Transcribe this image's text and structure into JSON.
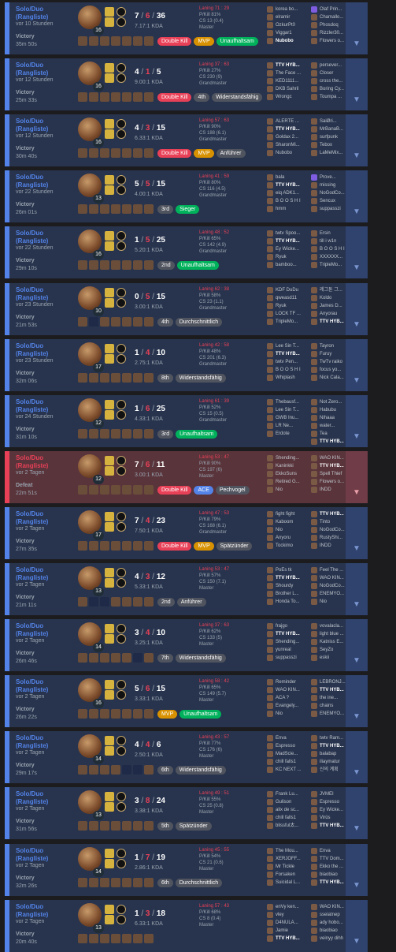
{
  "colors": {
    "win_bg": "#28344e",
    "win_accent": "#5383e8",
    "loss_bg": "#59343b",
    "loss_accent": "#e84057"
  },
  "icons": {
    "expand": "chevron-down-icon",
    "lane": "lane-icon",
    "rank": "rank-crest-icon"
  },
  "scroll_arrow": "▼",
  "matches": [
    {
      "id": "m1",
      "result_type": "win",
      "queue": "Solo/Duo\n(Rangliste)",
      "time_ago": "vor 10 Stunden",
      "result": "Victory",
      "duration": "35m 50s",
      "level": "16",
      "kda": {
        "k": "7",
        "d": "6",
        "a": "36"
      },
      "ratio": "7.17:1 KDA",
      "lane": "Laning 71 : 29",
      "kill_p": "P/Kill 81%",
      "cs": "CS 13 (0.4)",
      "rank": "Master",
      "tags": [
        {
          "label": "Double Kill",
          "style": "red"
        },
        {
          "label": "MVP",
          "style": "gold"
        },
        {
          "label": "Unaufhaltsam",
          "style": "green"
        }
      ],
      "blue": [
        "korea bo...",
        "elramir",
        "OzkurPt0",
        "Viggar1",
        "Nubobo"
      ],
      "red": [
        "Olaf Prin...",
        "Chamallo...",
        "Phosdoq",
        "Rizzler30...",
        "Flowers o..."
      ],
      "me": "blue-4",
      "ward": "red-0",
      "items": [
        1,
        1,
        1,
        1,
        1,
        1,
        1
      ]
    },
    {
      "id": "m2",
      "result_type": "win",
      "queue": "Solo/Duo\n(Rangliste)",
      "time_ago": "vor 12 Stunden",
      "result": "Victory",
      "duration": "25m 33s",
      "level": "16",
      "kda": {
        "k": "4",
        "d": "1",
        "a": "5"
      },
      "ratio": "9.00:1 KDA",
      "lane": "Laning 37 : 63",
      "kill_p": "P/Kill 27%",
      "cs": "CS 230 (9)",
      "rank": "Grandmaster",
      "tags": [
        {
          "label": "Double Kill",
          "style": "red"
        },
        {
          "label": "4th",
          "style": "grey"
        },
        {
          "label": "Widerstandsfähig",
          "style": "grey"
        }
      ],
      "blue": [
        "TTV HYB...",
        "The Face ...",
        "KED1111...",
        "DKB Sahril",
        "Wrongc"
      ],
      "red": [
        "persever...",
        "Closer",
        "cross the...",
        "Boring Cy...",
        "Toumpa ..."
      ],
      "me": "blue-0",
      "ward": "",
      "items": [
        1,
        1,
        1,
        1,
        1,
        1,
        1
      ]
    },
    {
      "id": "m3",
      "result_type": "win",
      "queue": "Solo/Duo\n(Rangliste)",
      "time_ago": "vor 12 Stunden",
      "result": "Victory",
      "duration": "30m 40s",
      "level": "16",
      "kda": {
        "k": "4",
        "d": "3",
        "a": "15"
      },
      "ratio": "6.33:1 KDA",
      "lane": "Laning 57 : 63",
      "kill_p": "P/Kill 90%",
      "cs": "CS 188 (6.1)",
      "rank": "Grandmaster",
      "tags": [
        {
          "label": "Double Kill",
          "style": "red"
        },
        {
          "label": "MVP",
          "style": "gold"
        },
        {
          "label": "Anführer",
          "style": "grey"
        }
      ],
      "blue": [
        "ALERTE ...",
        "TTV HYB...",
        "Goldax 2...",
        "SharonMi...",
        "Nubobo"
      ],
      "red": [
        "SaiØri...",
        "MrBanaB...",
        "surfpunk",
        "Tebox",
        "LaMeMix..."
      ],
      "me": "blue-1",
      "ward": "",
      "items": [
        1,
        1,
        1,
        1,
        1,
        1,
        1
      ]
    },
    {
      "id": "m4",
      "result_type": "win",
      "queue": "Solo/Duo\n(Rangliste)",
      "time_ago": "vor 22 Stunden",
      "result": "Victory",
      "duration": "26m 01s",
      "level": "13",
      "kda": {
        "k": "5",
        "d": "5",
        "a": "15"
      },
      "ratio": "4.00:1 KDA",
      "lane": "Laning 41 : 59",
      "kill_p": "P/Kill 80%",
      "cs": "CS 116 (4.5)",
      "rank": "Grandmaster",
      "tags": [
        {
          "label": "3rd",
          "style": "grey"
        },
        {
          "label": "Sieger",
          "style": "green"
        }
      ],
      "blue": [
        "bala",
        "TTV HYB...",
        "eiq ADK1...",
        "B O O S H I",
        "hmm"
      ],
      "red": [
        "Prove...",
        "missing",
        "NoGodCo...",
        "Sencux",
        "suppasszi"
      ],
      "me": "blue-1",
      "ward": "red-0",
      "items": [
        1,
        1,
        1,
        1,
        1,
        1,
        1
      ]
    },
    {
      "id": "m5",
      "result_type": "win",
      "queue": "Solo/Duo\n(Rangliste)",
      "time_ago": "vor 22 Stunden",
      "result": "Victory",
      "duration": "29m 10s",
      "level": "16",
      "kda": {
        "k": "1",
        "d": "5",
        "a": "25"
      },
      "ratio": "5.20:1 KDA",
      "lane": "Laning 48 : 52",
      "kill_p": "P/Kill 65%",
      "cs": "CS 142 (4.9)",
      "rank": "Grandmaster",
      "tags": [
        {
          "label": "2nd",
          "style": "grey"
        },
        {
          "label": "Unaufhaltsam",
          "style": "green"
        }
      ],
      "blue": [
        "twtv Spoo...",
        "TTV HYB...",
        "Ey Wicke...",
        "Ryuk",
        "bamboo..."
      ],
      "red": [
        "Ersin",
        "till i w1n",
        "B O O S H I",
        "XXXXXX...",
        "TripleMo..."
      ],
      "me": "blue-1",
      "ward": "",
      "items": [
        1,
        1,
        1,
        1,
        1,
        1,
        1
      ]
    },
    {
      "id": "m6",
      "result_type": "win",
      "queue": "Solo/Duo\n(Rangliste)",
      "time_ago": "vor 23 Stunden",
      "result": "Victory",
      "duration": "21m 53s",
      "level": "10",
      "kda": {
        "k": "0",
        "d": "5",
        "a": "15"
      },
      "ratio": "3.00:1 KDA",
      "lane": "Laning 62 : 38",
      "kill_p": "P/Kill 58%",
      "cs": "CS 23 (1.1)",
      "rank": "Grandmaster",
      "tags": [
        {
          "label": "4th",
          "style": "grey"
        },
        {
          "label": "Durchschnittlich",
          "style": "grey"
        }
      ],
      "blue": [
        "KDF DuDu",
        "qweasd11",
        "Ryuk",
        "LOCK TF ...",
        "TripleMo..."
      ],
      "red": [
        "레그톤 그...",
        "Koldo",
        "James D...",
        "Anyorau",
        "TTV HYB..."
      ],
      "me": "red-4",
      "ward": "",
      "items": [
        1,
        0,
        1,
        1,
        1,
        1,
        1
      ]
    },
    {
      "id": "m7",
      "result_type": "win",
      "queue": "Solo/Duo\n(Rangliste)",
      "time_ago": "vor 23 Stunden",
      "result": "Victory",
      "duration": "32m 06s",
      "level": "17",
      "kda": {
        "k": "1",
        "d": "4",
        "a": "10"
      },
      "ratio": "2.75:1 KDA",
      "lane": "Laning 42 : 58",
      "kill_p": "P/Kill 48%",
      "cs": "CS 201 (6.3)",
      "rank": "Grandmaster",
      "tags": [
        {
          "label": "8th",
          "style": "grey"
        },
        {
          "label": "Widerstandsfähig",
          "style": "grey"
        }
      ],
      "blue": [
        "Lee Sin T...",
        "TTV HYB...",
        "twtv Pen...",
        "B O O S H I",
        "Whiplash"
      ],
      "red": [
        "Tayron",
        "Furuy",
        "TwTv raiko",
        "focus yo...",
        "Nick Cala..."
      ],
      "me": "blue-1",
      "ward": "",
      "items": [
        1,
        1,
        1,
        1,
        1,
        1,
        1
      ]
    },
    {
      "id": "m8",
      "result_type": "win",
      "queue": "Solo/Duo\n(Rangliste)",
      "time_ago": "vor 24 Stunden",
      "result": "Victory",
      "duration": "31m 10s",
      "level": "12",
      "kda": {
        "k": "1",
        "d": "6",
        "a": "25"
      },
      "ratio": "4.33:1 KDA",
      "lane": "Laning 61 : 39",
      "kill_p": "P/Kill 52%",
      "cs": "CS 15 (0.5)",
      "rank": "Grandmaster",
      "tags": [
        {
          "label": "3rd",
          "style": "grey"
        },
        {
          "label": "Unaufhaltsam",
          "style": "green"
        }
      ],
      "blue": [
        "Thebausf...",
        "Lee Sin T...",
        "GWB Inu...",
        "LR Ne...",
        "Erdote"
      ],
      "red": [
        "Not Zero...",
        "Habubu",
        "Nihaaa",
        "water...",
        "Tea"
      ],
      "extra": "TTV HYB...",
      "me": "red-5",
      "ward": "",
      "items": [
        1,
        1,
        1,
        1,
        1,
        1,
        1
      ]
    },
    {
      "id": "m9",
      "result_type": "loss",
      "queue": "Solo/Duo\n(Rangliste)",
      "time_ago": "vor 2 Tagen",
      "result": "Defeat",
      "duration": "22m 51s",
      "level": "12",
      "kda": {
        "k": "7",
        "d": "6",
        "a": "11"
      },
      "ratio": "3.00:1 KDA",
      "lane": "Laning 53 : 47",
      "kill_p": "P/Kill 90%",
      "cs": "CS 197 (6)",
      "rank": "Master",
      "tags": [
        {
          "label": "Double Kill",
          "style": "red"
        },
        {
          "label": "ACE",
          "style": "blue"
        },
        {
          "label": "Pechvogel",
          "style": "grey"
        }
      ],
      "blue": [
        "Shending...",
        "Kaninkki",
        "EkkoSuns",
        "Retired G...",
        "Nio"
      ],
      "red": [
        "WAO KIN...",
        "TTV HYB...",
        "Spell Thief",
        "Flowers o...",
        "INDD"
      ],
      "me": "red-1",
      "ward": "",
      "items": [
        1,
        1,
        1,
        1,
        1,
        1,
        1
      ]
    },
    {
      "id": "m10",
      "result_type": "win",
      "queue": "Solo/Duo\n(Rangliste)",
      "time_ago": "vor 2 Tagen",
      "result": "Victory",
      "duration": "27m 35s",
      "level": "17",
      "kda": {
        "k": "7",
        "d": "4",
        "a": "23"
      },
      "ratio": "7.50:1 KDA",
      "lane": "Laning 47 : 53",
      "kill_p": "P/Kill 79%",
      "cs": "CS 168 (6.1)",
      "rank": "Grandmaster",
      "tags": [
        {
          "label": "Double Kill",
          "style": "red"
        },
        {
          "label": "MVP",
          "style": "gold"
        },
        {
          "label": "Spätzünder",
          "style": "grey"
        }
      ],
      "blue": [
        "fight fight",
        "Kaboom",
        "Nio",
        "Anyoru",
        "Tockimo"
      ],
      "red": [
        "TTV HYB...",
        "Tinto",
        "NoGodCo...",
        "RustyShi...",
        "INDD"
      ],
      "me": "red-0",
      "ward": "",
      "items": [
        1,
        1,
        1,
        1,
        1,
        1,
        1
      ]
    },
    {
      "id": "m11",
      "result_type": "win",
      "queue": "Solo/Duo\n(Rangliste)",
      "time_ago": "vor 2 Tagen",
      "result": "Victory",
      "duration": "21m 11s",
      "level": "13",
      "kda": {
        "k": "4",
        "d": "3",
        "a": "12"
      },
      "ratio": "5.33:1 KDA",
      "lane": "Laning 53 : 47",
      "kill_p": "P/Kill 57%",
      "cs": "CS 150 (7.1)",
      "rank": "Master",
      "tags": [
        {
          "label": "2nd",
          "style": "grey"
        },
        {
          "label": "Anführer",
          "style": "grey"
        }
      ],
      "blue": [
        "PoEs tk",
        "TTV HYB...",
        "Shourdy",
        "Brother L...",
        "Honda To..."
      ],
      "red": [
        "Feel The ...",
        "WAO KIN...",
        "NoGodCo...",
        "ENEMYO...",
        "Nio"
      ],
      "me": "blue-1",
      "ward": "",
      "items": [
        1,
        0,
        0,
        1,
        1,
        1,
        1
      ]
    },
    {
      "id": "m12",
      "result_type": "win",
      "queue": "Solo/Duo\n(Rangliste)",
      "time_ago": "vor 2 Tagen",
      "result": "Victory",
      "duration": "26m 46s",
      "level": "14",
      "kda": {
        "k": "3",
        "d": "4",
        "a": "10"
      },
      "ratio": "3.25:1 KDA",
      "lane": "Laning 37 : 63",
      "kill_p": "P/Kill 62%",
      "cs": "CS 133 (5)",
      "rank": "Master",
      "tags": [
        {
          "label": "7th",
          "style": "grey"
        },
        {
          "label": "Widerstandsfähig",
          "style": "grey"
        }
      ],
      "blue": [
        "frajgo",
        "TTV HYB...",
        "Shending...",
        "yunreal",
        "suppasszi"
      ],
      "red": [
        "vovalacla...",
        "light blue ...",
        "Katniss E...",
        "SeyZo",
        "eskii"
      ],
      "me": "blue-1",
      "ward": "",
      "items": [
        1,
        1,
        1,
        1,
        1,
        0,
        1
      ]
    },
    {
      "id": "m13",
      "result_type": "win",
      "queue": "Solo/Duo\n(Rangliste)",
      "time_ago": "vor 2 Tagen",
      "result": "Victory",
      "duration": "26m 22s",
      "level": "16",
      "kda": {
        "k": "5",
        "d": "6",
        "a": "15"
      },
      "ratio": "3.33:1 KDA",
      "lane": "Laning 58 : 42",
      "kill_p": "P/Kill 65%",
      "cs": "CS 149 (5.7)",
      "rank": "Master",
      "tags": [
        {
          "label": "MVP",
          "style": "gold"
        },
        {
          "label": "Unaufhaltsam",
          "style": "green"
        }
      ],
      "blue": [
        "Reminder",
        "WAO KIN...",
        "ACA ?",
        "Evangely...",
        "Nio"
      ],
      "red": [
        "LEBRONJ...",
        "TTV HYB...",
        "the ine...",
        "chains",
        "ENEMYO..."
      ],
      "me": "red-1",
      "ward": "",
      "items": [
        1,
        1,
        1,
        1,
        1,
        1,
        1
      ]
    },
    {
      "id": "m14",
      "result_type": "win",
      "queue": "Solo/Duo\n(Rangliste)",
      "time_ago": "vor 2 Tagen",
      "result": "Victory",
      "duration": "29m 17s",
      "level": "14",
      "kda": {
        "k": "4",
        "d": "4",
        "a": "6"
      },
      "ratio": "2.50:1 KDA",
      "lane": "Laning 43 : 57",
      "kill_p": "P/Kill 77%",
      "cs": "CS 176 (6)",
      "rank": "Master",
      "tags": [
        {
          "label": "6th",
          "style": "grey"
        },
        {
          "label": "Widerstandsfähig",
          "style": "grey"
        }
      ],
      "blue": [
        "Enva",
        "Espresso",
        "MadScie...",
        "chill falls1",
        "KC NEXT ..."
      ],
      "red": [
        "twtv Ram...",
        "TTV HYB...",
        "balabap",
        "iliaymatur",
        "신의 계획"
      ],
      "me": "red-1",
      "ward": "",
      "items": [
        1,
        1,
        1,
        1,
        0,
        0,
        1
      ]
    },
    {
      "id": "m15",
      "result_type": "win",
      "queue": "Solo/Duo\n(Rangliste)",
      "time_ago": "vor 2 Tagen",
      "result": "Victory",
      "duration": "31m 56s",
      "level": "13",
      "kda": {
        "k": "3",
        "d": "8",
        "a": "24"
      },
      "ratio": "3.38:1 KDA",
      "lane": "Laning 49 : 51",
      "kill_p": "P/Kill 55%",
      "cs": "CS 25 (0.8)",
      "rank": "Master",
      "tags": [
        {
          "label": "5th",
          "style": "grey"
        },
        {
          "label": "Spätzünder",
          "style": "grey"
        }
      ],
      "blue": [
        "Frank Lu...",
        "Gulison",
        "alix de sc...",
        "chill falls1",
        "blissful太..."
      ],
      "red": [
        "JVMEI",
        "Espresso",
        "Ey Wicke...",
        "Virüs",
        "TTV HYB..."
      ],
      "me": "red-4",
      "ward": "",
      "items": [
        1,
        1,
        1,
        1,
        1,
        1,
        1
      ]
    },
    {
      "id": "m16",
      "result_type": "win",
      "queue": "Solo/Duo\n(Rangliste)",
      "time_ago": "vor 2 Tagen",
      "result": "Victory",
      "duration": "32m 26s",
      "level": "14",
      "kda": {
        "k": "1",
        "d": "7",
        "a": "19"
      },
      "ratio": "2.86:1 KDA",
      "lane": "Laning 45 : 55",
      "kill_p": "P/Kill 54%",
      "cs": "CS 21 (0.6)",
      "rank": "Master",
      "tags": [
        {
          "label": "6th",
          "style": "grey"
        },
        {
          "label": "Durchschnittlich",
          "style": "grey"
        }
      ],
      "blue": [
        "The Mou...",
        "XERJOFF...",
        "Mr Tickle",
        "Forsaken",
        "Suicidal L..."
      ],
      "red": [
        "Enva",
        "TTV Dom...",
        "Ekko the ...",
        "biaobiao",
        "TTV HYB..."
      ],
      "me": "red-4",
      "ward": "",
      "items": [
        1,
        1,
        1,
        1,
        1,
        1,
        1
      ]
    },
    {
      "id": "m17",
      "result_type": "win",
      "queue": "Solo/Duo\n(Rangliste)",
      "time_ago": "vor 2 Tagen",
      "result": "Victory",
      "duration": "20m 40s",
      "level": "13",
      "kda": {
        "k": "1",
        "d": "3",
        "a": "18"
      },
      "ratio": "6.33:1 KDA",
      "lane": "Laning 57 : 43",
      "kill_p": "P/Kill 68%",
      "cs": "CS 8 (0.4)",
      "rank": "Master",
      "tags": [],
      "blue": [
        "enVy ken...",
        "vley",
        "D4NULA...",
        "Jamie",
        "TTV HYB..."
      ],
      "red": [
        "WAO KIN...",
        "sseiatnep",
        "ady hobo...",
        "biaobiao",
        "veinyy dihh"
      ],
      "me": "blue-4",
      "ward": "",
      "items": [
        1,
        1,
        1,
        1,
        1,
        1,
        1
      ]
    }
  ]
}
